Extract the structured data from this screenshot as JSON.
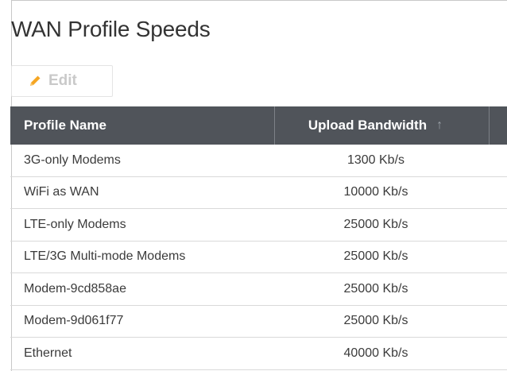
{
  "title": "WAN Profile Speeds",
  "toolbar": {
    "edit_label": "Edit",
    "edit_icon": "pencil-icon"
  },
  "table": {
    "columns": [
      {
        "label": "Profile Name"
      },
      {
        "label": "Upload Bandwidth",
        "sort_icon": "↑"
      }
    ],
    "rows": [
      {
        "name": "3G-only Modems",
        "upload": "1300 Kb/s"
      },
      {
        "name": "WiFi as WAN",
        "upload": "10000 Kb/s"
      },
      {
        "name": "LTE-only Modems",
        "upload": "25000 Kb/s"
      },
      {
        "name": "LTE/3G Multi-mode Modems",
        "upload": "25000 Kb/s"
      },
      {
        "name": "Modem-9cd858ae",
        "upload": "25000 Kb/s"
      },
      {
        "name": "Modem-9d061f77",
        "upload": "25000 Kb/s"
      },
      {
        "name": "Ethernet",
        "upload": "40000 Kb/s"
      }
    ]
  },
  "colors": {
    "header_bg": "#50545a",
    "header_text": "#ffffff",
    "pencil": "#f5a623",
    "edit_text": "#c9c9c9"
  }
}
